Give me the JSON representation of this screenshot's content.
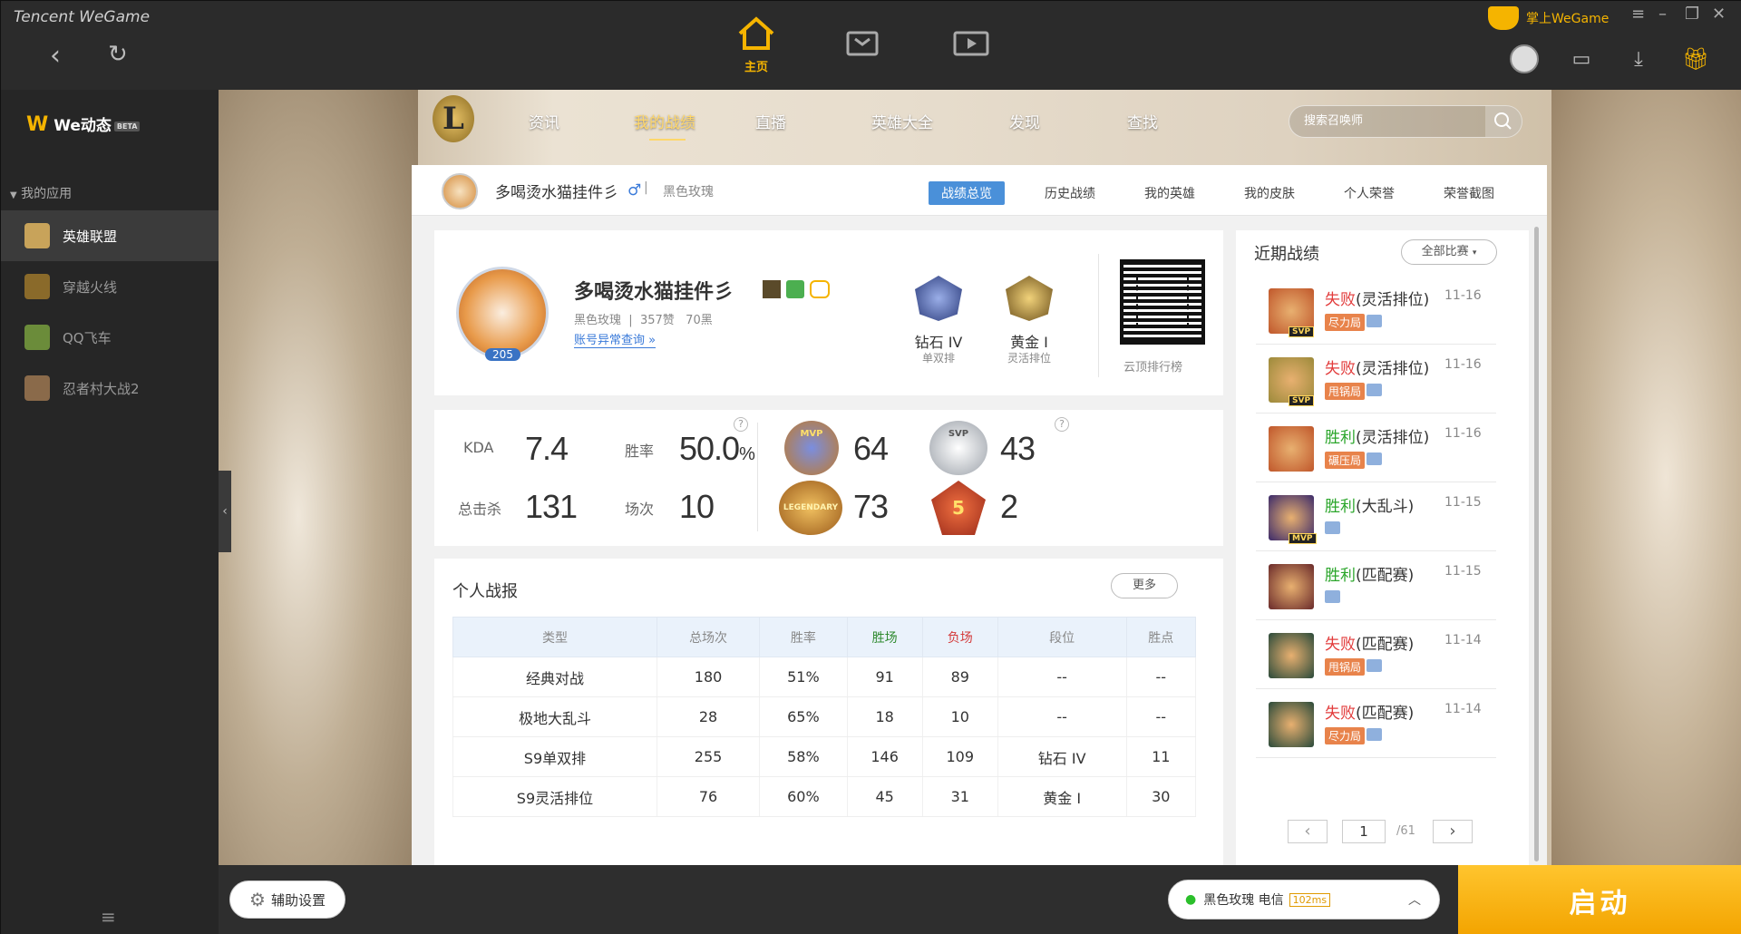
{
  "window": {
    "brand": "Tencent WeGame",
    "mobile_label": "掌上WeGame"
  },
  "topnav": [
    {
      "label": "主页"
    }
  ],
  "sidebar": {
    "title": "We动态",
    "beta": "BETA",
    "section": "我的应用",
    "apps": [
      {
        "label": "英雄联盟",
        "color": "#c8a35a"
      },
      {
        "label": "穿越火线",
        "color": "#b8872c"
      },
      {
        "label": "QQ飞车",
        "color": "#6b8c3a"
      },
      {
        "label": "忍者村大战2",
        "color": "#8a6a4a"
      }
    ]
  },
  "gamenav": {
    "tabs": [
      "资讯",
      "我的战绩",
      "直播",
      "英雄大全",
      "发现",
      "查找"
    ],
    "active": "我的战绩",
    "search_placeholder": "搜索召唤师"
  },
  "profile_header": {
    "name": "多喝烫水猫挂件彡",
    "gender": "♂",
    "server": "黑色玫瑰",
    "tabs": [
      "战绩总览",
      "历史战绩",
      "我的英雄",
      "我的皮肤",
      "个人荣誉",
      "荣誉截图"
    ]
  },
  "profile": {
    "name": "多喝烫水猫挂件彡",
    "level": "205",
    "server": "黑色玫瑰",
    "likes": "357赞",
    "blacks": "70黑",
    "abnormal_link": "账号异常查询 »",
    "rank1": {
      "tier": "钻石 IV",
      "queue": "单双排"
    },
    "rank2": {
      "tier": "黄金 Ⅰ",
      "queue": "灵活排位"
    },
    "qr_label": "云顶排行榜"
  },
  "stats": {
    "kda_label": "KDA",
    "kda": "7.4",
    "winrate_label": "胜率",
    "winrate": "50.0",
    "winrate_unit": "%",
    "kills_label": "总击杀",
    "kills": "131",
    "games_label": "场次",
    "games": "10",
    "mvp": "64",
    "svp": "43",
    "legendary": "73",
    "penta": "2",
    "mvp_badge": "MVP",
    "svp_badge": "SVP",
    "legendary_badge": "LEGENDARY",
    "penta_badge": "5"
  },
  "report": {
    "title": "个人战报",
    "more": "更多",
    "headers": [
      "类型",
      "总场次",
      "胜率",
      "胜场",
      "负场",
      "段位",
      "胜点"
    ],
    "rows": [
      [
        "经典对战",
        "180",
        "51%",
        "91",
        "89",
        "--",
        "--"
      ],
      [
        "极地大乱斗",
        "28",
        "65%",
        "18",
        "10",
        "--",
        "--"
      ],
      [
        "S9单双排",
        "255",
        "58%",
        "146",
        "109",
        "钻石 IV",
        "11"
      ],
      [
        "S9灵活排位",
        "76",
        "60%",
        "45",
        "31",
        "黄金 Ⅰ",
        "30"
      ]
    ]
  },
  "recent": {
    "title": "近期战绩",
    "filter": "全部比赛",
    "items": [
      {
        "result": "失败",
        "mode": "(灵活排位)",
        "date": "11-16",
        "tag": "尽力局",
        "badge": "SVP",
        "win": false,
        "color": "#c0572b"
      },
      {
        "result": "失败",
        "mode": "(灵活排位)",
        "date": "11-16",
        "tag": "甩锅局",
        "badge": "SVP",
        "win": false,
        "color": "#9c8a3a"
      },
      {
        "result": "胜利",
        "mode": "(灵活排位)",
        "date": "11-16",
        "tag": "碾压局",
        "badge": "",
        "win": true,
        "color": "#c0572b"
      },
      {
        "result": "胜利",
        "mode": "(大乱斗)",
        "date": "11-15",
        "tag": "",
        "badge": "MVP",
        "win": true,
        "color": "#3b2a6a"
      },
      {
        "result": "胜利",
        "mode": "(匹配赛)",
        "date": "11-15",
        "tag": "",
        "badge": "",
        "win": true,
        "color": "#6a2a2a"
      },
      {
        "result": "失败",
        "mode": "(匹配赛)",
        "date": "11-14",
        "tag": "甩锅局",
        "badge": "",
        "win": false,
        "color": "#2a4a3a"
      },
      {
        "result": "失败",
        "mode": "(匹配赛)",
        "date": "11-14",
        "tag": "尽力局",
        "badge": "",
        "win": false,
        "color": "#2a4a3a"
      }
    ],
    "page": "1",
    "total": "/61"
  },
  "bottom": {
    "assist": "辅助设置",
    "server": "黑色玫瑰 电信",
    "ping": "102ms",
    "start": "启动"
  }
}
